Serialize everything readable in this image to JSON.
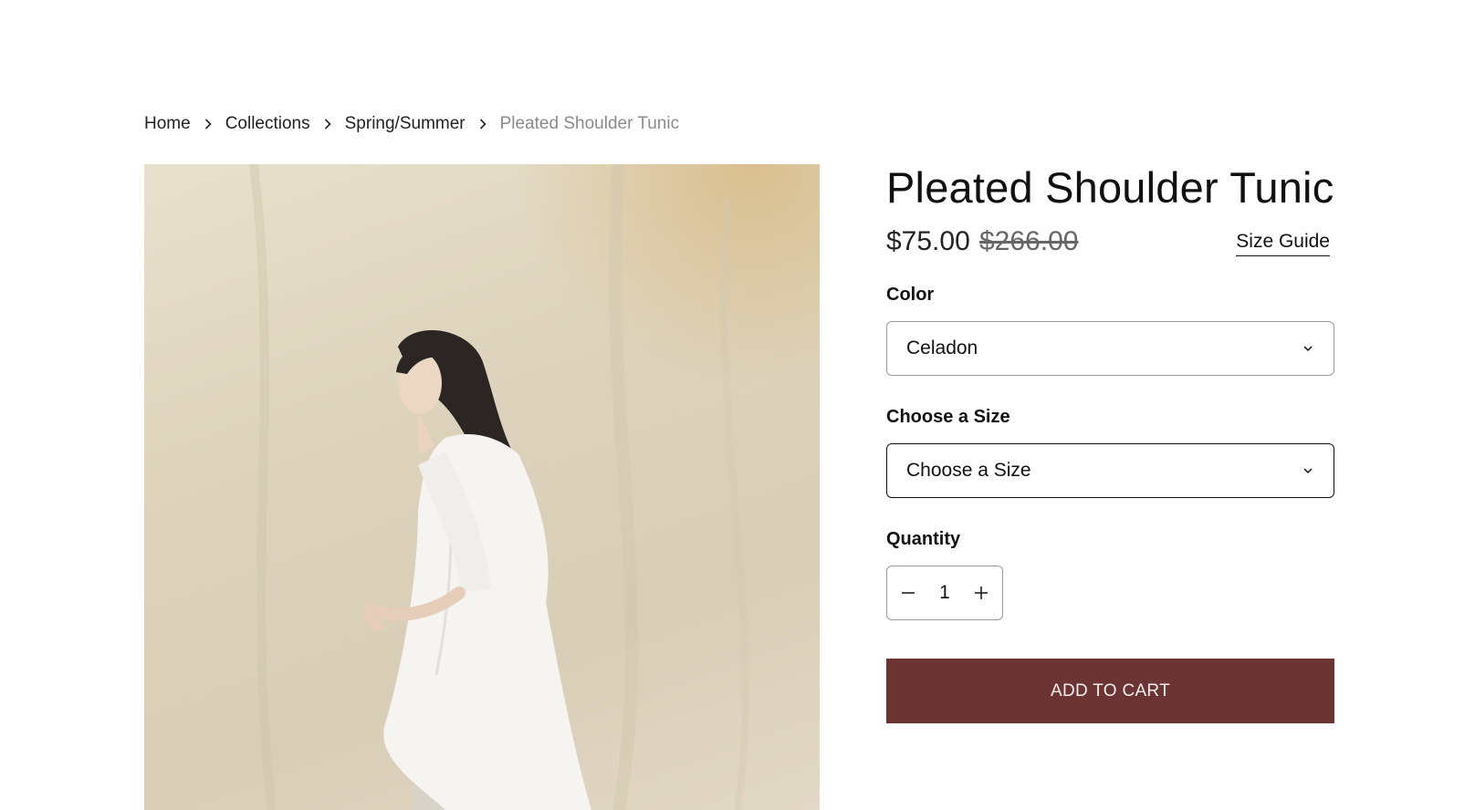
{
  "breadcrumb": {
    "items": [
      {
        "label": "Home"
      },
      {
        "label": "Collections"
      },
      {
        "label": "Spring/Summer"
      },
      {
        "label": "Pleated Shoulder Tunic"
      }
    ]
  },
  "product": {
    "title": "Pleated Shoulder Tunic",
    "price_sale": "$75.00",
    "price_original": "$266.00",
    "size_guide_label": "Size Guide"
  },
  "options": {
    "color": {
      "label": "Color",
      "selected": "Celadon"
    },
    "size": {
      "label": "Choose a Size",
      "selected": "Choose a Size"
    }
  },
  "quantity": {
    "label": "Quantity",
    "value": "1"
  },
  "actions": {
    "add_to_cart_label": "ADD TO CART"
  },
  "icons": {
    "breadcrumb_separator": "chevron-right-icon",
    "select_caret": "chevron-down-icon",
    "decrease": "minus-icon",
    "increase": "plus-icon"
  },
  "colors": {
    "add_to_cart_bg": "#6b3433",
    "muted_text": "#8a8a8a"
  }
}
